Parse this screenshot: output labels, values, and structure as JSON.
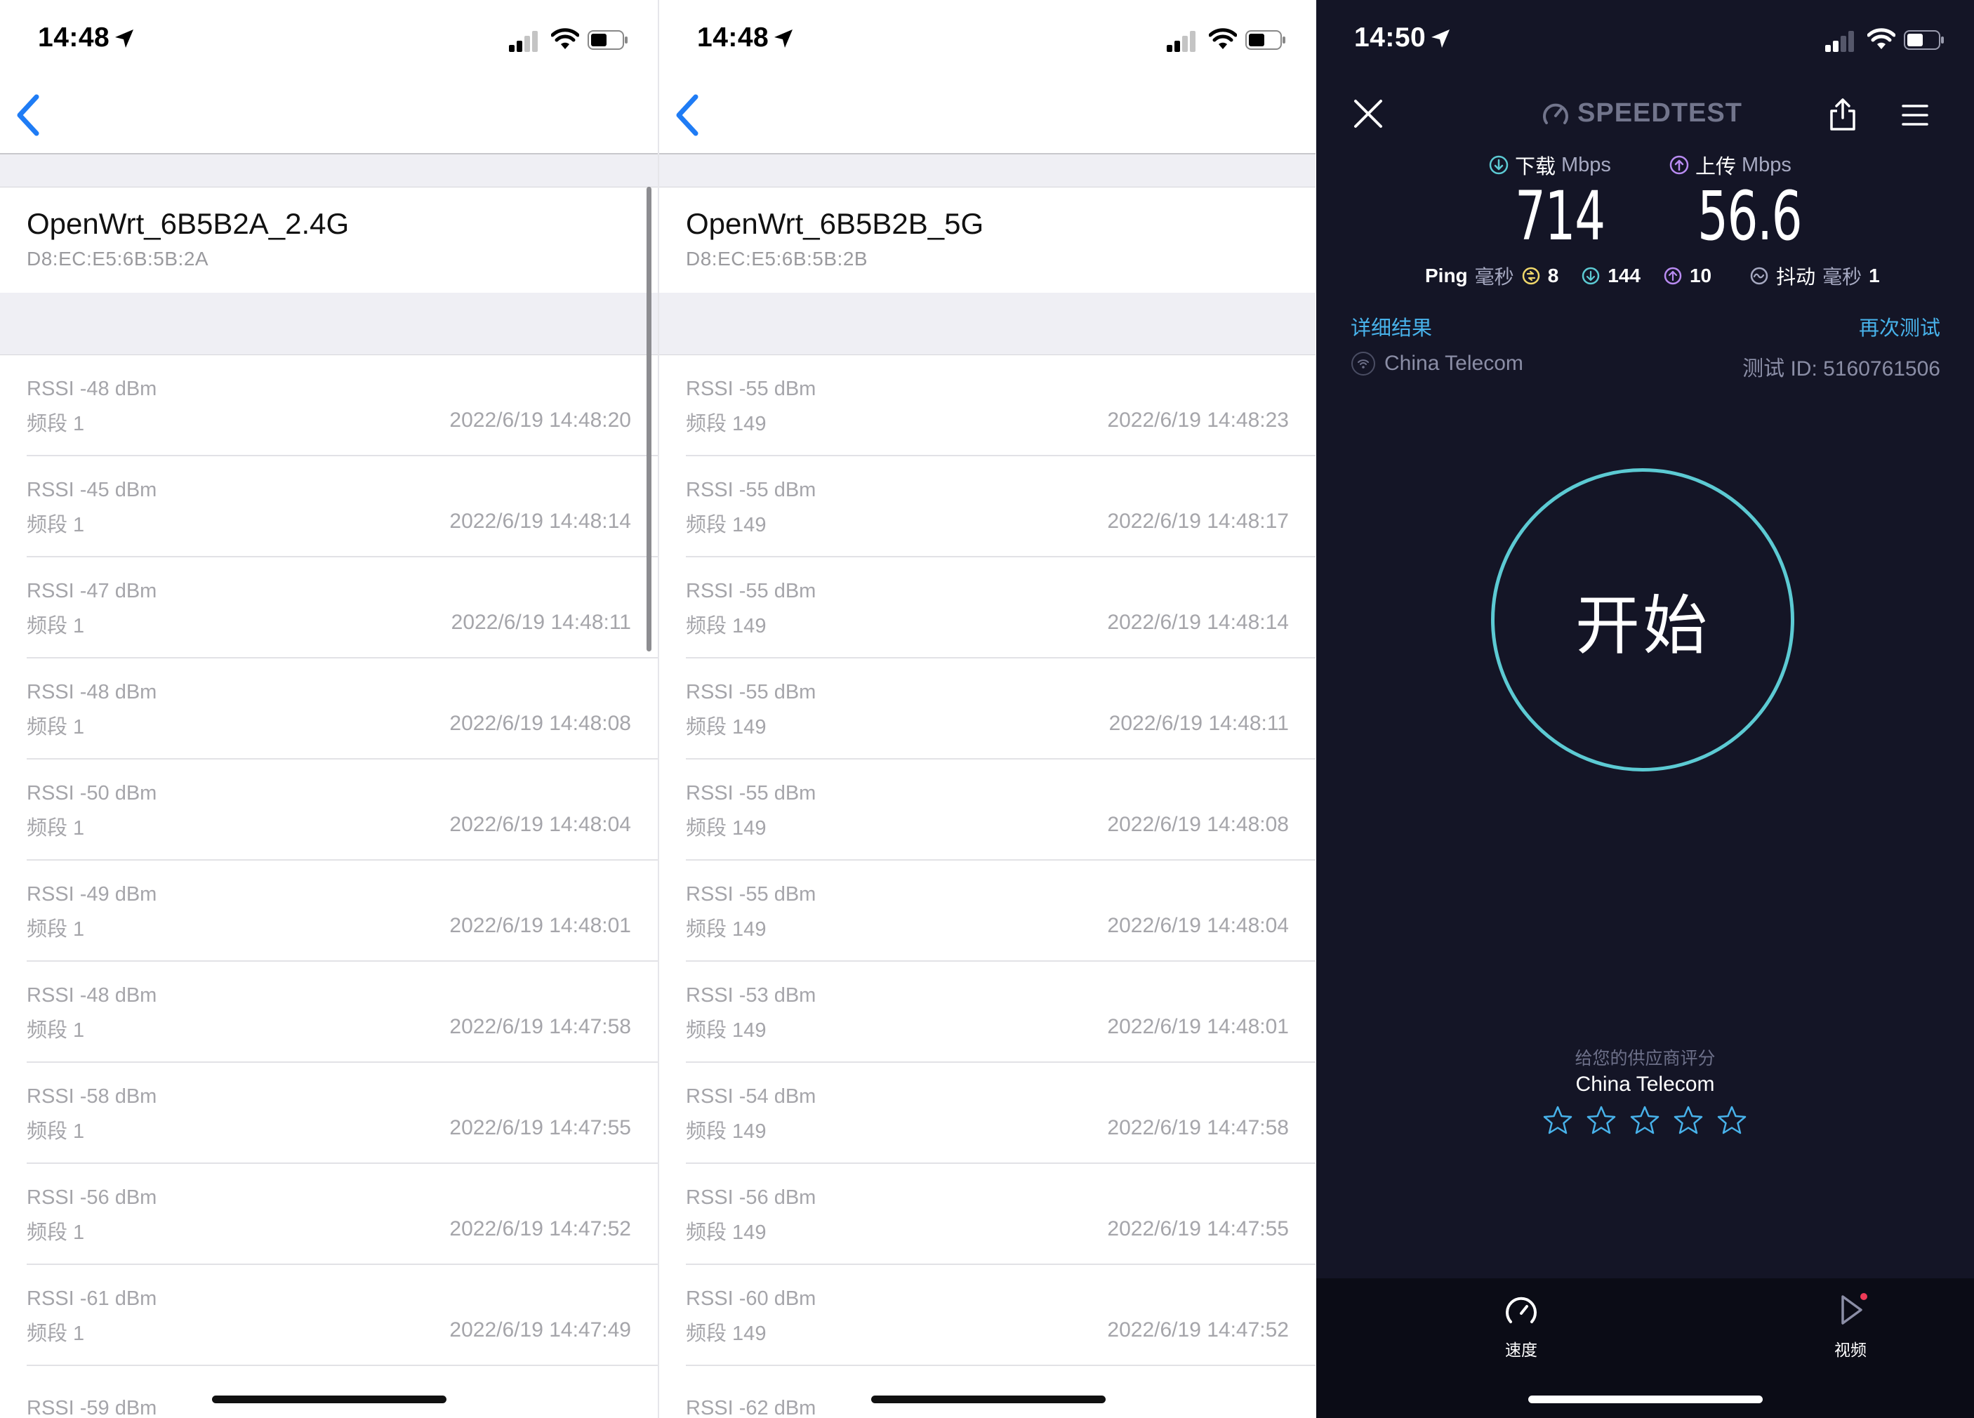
{
  "panel1": {
    "time": "14:48",
    "ssid": "OpenWrt_6B5B2A_2.4G",
    "mac": "D8:EC:E5:6B:5B:2A",
    "rows": [
      {
        "rssi": "RSSI -48 dBm",
        "band": "频段 1",
        "time": "2022/6/19 14:48:20"
      },
      {
        "rssi": "RSSI -45 dBm",
        "band": "频段 1",
        "time": "2022/6/19 14:48:14"
      },
      {
        "rssi": "RSSI -47 dBm",
        "band": "频段 1",
        "time": "2022/6/19 14:48:11"
      },
      {
        "rssi": "RSSI -48 dBm",
        "band": "频段 1",
        "time": "2022/6/19 14:48:08"
      },
      {
        "rssi": "RSSI -50 dBm",
        "band": "频段 1",
        "time": "2022/6/19 14:48:04"
      },
      {
        "rssi": "RSSI -49 dBm",
        "band": "频段 1",
        "time": "2022/6/19 14:48:01"
      },
      {
        "rssi": "RSSI -48 dBm",
        "band": "频段 1",
        "time": "2022/6/19 14:47:58"
      },
      {
        "rssi": "RSSI -58 dBm",
        "band": "频段 1",
        "time": "2022/6/19 14:47:55"
      },
      {
        "rssi": "RSSI -56 dBm",
        "band": "频段 1",
        "time": "2022/6/19 14:47:52"
      },
      {
        "rssi": "RSSI -61 dBm",
        "band": "频段 1",
        "time": "2022/6/19 14:47:49"
      },
      {
        "rssi": "RSSI -59 dBm",
        "band": "",
        "time": ""
      }
    ]
  },
  "panel2": {
    "time": "14:48",
    "ssid": "OpenWrt_6B5B2B_5G",
    "mac": "D8:EC:E5:6B:5B:2B",
    "rows": [
      {
        "rssi": "RSSI -55 dBm",
        "band": "频段 149",
        "time": "2022/6/19 14:48:23"
      },
      {
        "rssi": "RSSI -55 dBm",
        "band": "频段 149",
        "time": "2022/6/19 14:48:17"
      },
      {
        "rssi": "RSSI -55 dBm",
        "band": "频段 149",
        "time": "2022/6/19 14:48:14"
      },
      {
        "rssi": "RSSI -55 dBm",
        "band": "频段 149",
        "time": "2022/6/19 14:48:11"
      },
      {
        "rssi": "RSSI -55 dBm",
        "band": "频段 149",
        "time": "2022/6/19 14:48:08"
      },
      {
        "rssi": "RSSI -55 dBm",
        "band": "频段 149",
        "time": "2022/6/19 14:48:04"
      },
      {
        "rssi": "RSSI -53 dBm",
        "band": "频段 149",
        "time": "2022/6/19 14:48:01"
      },
      {
        "rssi": "RSSI -54 dBm",
        "band": "频段 149",
        "time": "2022/6/19 14:47:58"
      },
      {
        "rssi": "RSSI -56 dBm",
        "band": "频段 149",
        "time": "2022/6/19 14:47:55"
      },
      {
        "rssi": "RSSI -60 dBm",
        "band": "频段 149",
        "time": "2022/6/19 14:47:52"
      },
      {
        "rssi": "RSSI -62 dBm",
        "band": "",
        "time": ""
      }
    ]
  },
  "speedtest": {
    "time": "14:50",
    "logo": "SPEEDTEST",
    "download_label": "下载",
    "upload_label": "上传",
    "unit": "Mbps",
    "download_value": "714",
    "upload_value": "56.6",
    "ping_label": "Ping",
    "ms_label": "毫秒",
    "ping_idle": "8",
    "ping_down": "144",
    "ping_up": "10",
    "jitter_label": "抖动",
    "jitter_value": "1",
    "detail_link": "详细结果",
    "retest_link": "再次测试",
    "isp": "China Telecom",
    "test_id": "测试 ID: 5160761506",
    "start_button": "开始",
    "rate_heading": "给您的供应商评分",
    "rate_isp": "China Telecom",
    "rating_stars": 0,
    "tab_speed": "速度",
    "tab_video": "视频",
    "colors": {
      "background": "#141526",
      "accent": "#5ccad3",
      "link": "#48b2ea",
      "download": "#5ccad3",
      "upload": "#b98bf2",
      "ping": "#f0d86a"
    }
  }
}
